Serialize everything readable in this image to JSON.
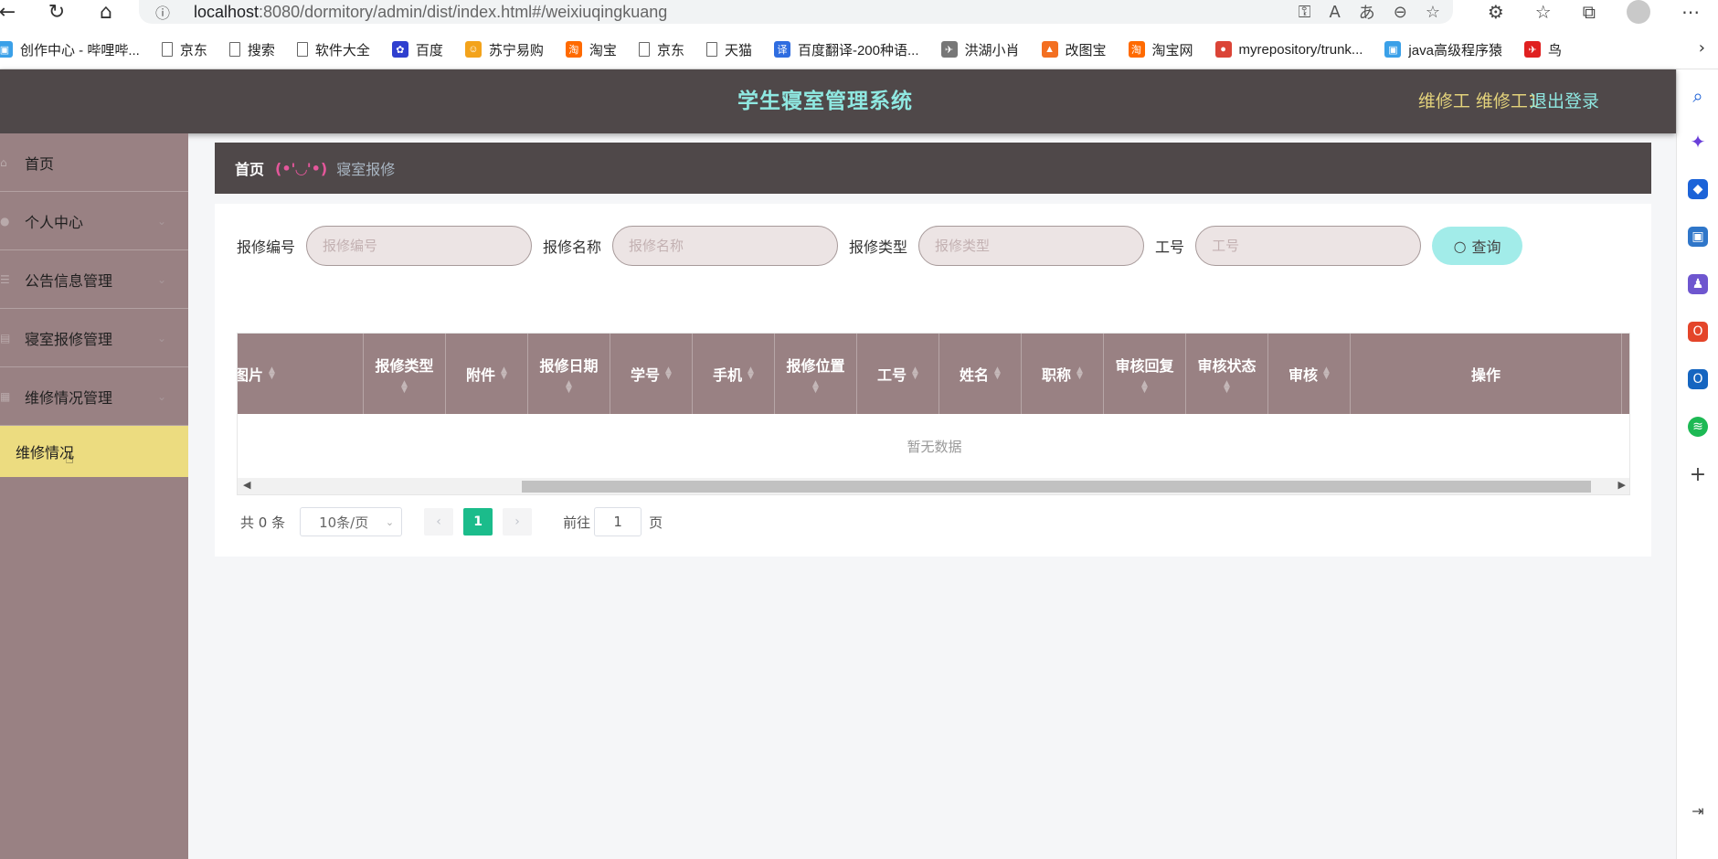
{
  "browser": {
    "address": {
      "host": "localhost",
      "path": ":8080/dormitory/admin/dist/index.html#/weixiuqingkuang"
    },
    "bookmarks": [
      {
        "label": "创作中心 - 哔哩哔...",
        "icon": "bilibili-icon",
        "color": "#3aa0e8"
      },
      {
        "label": "京东",
        "icon": "page-icon",
        "color": "#666666"
      },
      {
        "label": "搜索",
        "icon": "page-icon",
        "color": "#666666"
      },
      {
        "label": "软件大全",
        "icon": "page-icon",
        "color": "#666666"
      },
      {
        "label": "百度",
        "icon": "baidu-icon",
        "color": "#2f3fcf"
      },
      {
        "label": "苏宁易购",
        "icon": "suning-icon",
        "color": "#f3a31b"
      },
      {
        "label": "淘宝",
        "icon": "taobao-icon",
        "color": "#ff6a00"
      },
      {
        "label": "京东",
        "icon": "page-icon",
        "color": "#666666"
      },
      {
        "label": "天猫",
        "icon": "page-icon",
        "color": "#666666"
      },
      {
        "label": "百度翻译-200种语...",
        "icon": "translate-icon",
        "color": "#2f6de0"
      },
      {
        "label": "洪湖小肖",
        "icon": "bird-icon",
        "color": "#777777"
      },
      {
        "label": "改图宝",
        "icon": "gaitubao-icon",
        "color": "#f36f21"
      },
      {
        "label": "淘宝网",
        "icon": "taobao-icon",
        "color": "#ff6a00"
      },
      {
        "label": "myrepository/trunk...",
        "icon": "chrome-icon",
        "color": "#db4437"
      },
      {
        "label": "java高级程序猿",
        "icon": "bilibili-icon",
        "color": "#3aa0e8"
      },
      {
        "label": "鸟",
        "icon": "bird-red-icon",
        "color": "#e02020"
      }
    ]
  },
  "header": {
    "title": "学生寝室管理系统",
    "user": "维修工 维修工1",
    "logout": "退出登录"
  },
  "sidebar": {
    "items": [
      {
        "label": "首页",
        "icon": "home-icon",
        "has_children": false
      },
      {
        "label": "个人中心",
        "icon": "user-icon",
        "has_children": true
      },
      {
        "label": "公告信息管理",
        "icon": "list-icon",
        "has_children": true
      },
      {
        "label": "寝室报修管理",
        "icon": "menu-icon",
        "has_children": true
      },
      {
        "label": "维修情况管理",
        "icon": "grid-icon",
        "has_children": true
      }
    ],
    "active_sub": {
      "label": "维修情况"
    }
  },
  "breadcrumb": {
    "home": "首页",
    "face": "(•'◡'•)",
    "current": "寝室报修"
  },
  "search": {
    "fields": [
      {
        "label": "报修编号",
        "placeholder": "报修编号",
        "value": ""
      },
      {
        "label": "报修名称",
        "placeholder": "报修名称",
        "value": ""
      },
      {
        "label": "报修类型",
        "placeholder": "报修类型",
        "value": ""
      },
      {
        "label": "工号",
        "placeholder": "工号",
        "value": ""
      }
    ],
    "button": "查询"
  },
  "table": {
    "columns": [
      {
        "label": "图片",
        "sortable": true
      },
      {
        "label": "报修类型",
        "sortable": true
      },
      {
        "label": "附件",
        "sortable": true
      },
      {
        "label": "报修日期",
        "sortable": true
      },
      {
        "label": "学号",
        "sortable": true
      },
      {
        "label": "手机",
        "sortable": true
      },
      {
        "label": "报修位置",
        "sortable": true
      },
      {
        "label": "工号",
        "sortable": true
      },
      {
        "label": "姓名",
        "sortable": true
      },
      {
        "label": "职称",
        "sortable": true
      },
      {
        "label": "审核回复",
        "sortable": true
      },
      {
        "label": "审核状态",
        "sortable": true
      },
      {
        "label": "审核",
        "sortable": true
      },
      {
        "label": "操作",
        "sortable": false
      }
    ],
    "empty_text": "暂无数据",
    "scroll_fraction": 0.2
  },
  "pagination": {
    "total": "共 0 条",
    "page_size": "10条/页",
    "current_page": "1",
    "goto_label": "前往",
    "goto_value": "1",
    "page_suffix": "页"
  },
  "colors": {
    "header_bg": "#4f4849",
    "sidebar_bg": "#998183",
    "active_sub_bg": "#ecdc80",
    "title_color": "#8fe8e1",
    "user_color": "#e3d27b",
    "search_btn": "#a2ece9",
    "pager_active": "#1bbc8b"
  }
}
